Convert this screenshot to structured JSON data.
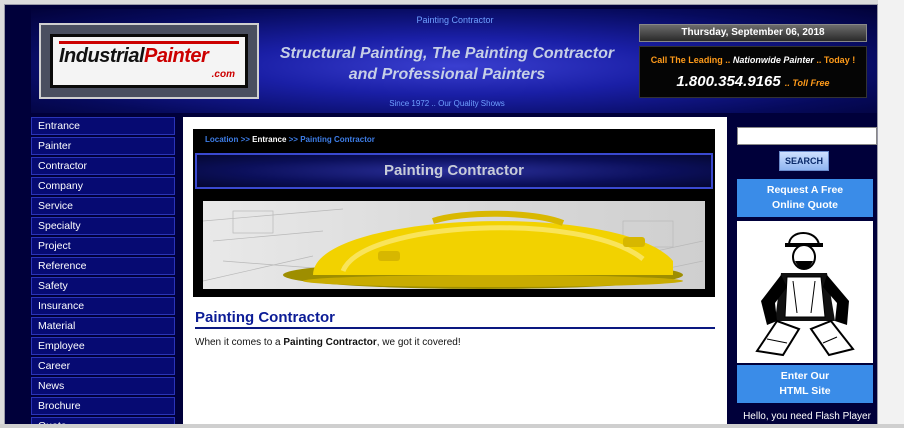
{
  "header": {
    "top_label": "Painting Contractor",
    "logo": {
      "word1": "Industrial",
      "word2": "Painter",
      "tld": ".com"
    },
    "tagline_line1": "Structural Painting, The Painting Contractor",
    "tagline_line2": "and Professional Painters",
    "since": "Since 1972 .. Our Quality Shows",
    "date": "Thursday, September 06, 2018",
    "call_prefix": "Call The Leading ..",
    "call_emph": "Nationwide Painter",
    "call_suffix": ".. Today !",
    "phone": "1.800.354.9165",
    "phone_suffix": ".. Toll Free"
  },
  "sidebar": {
    "items": [
      {
        "label": "Entrance"
      },
      {
        "label": "Painter"
      },
      {
        "label": "Contractor"
      },
      {
        "label": "Company"
      },
      {
        "label": "Service"
      },
      {
        "label": "Specialty"
      },
      {
        "label": "Project"
      },
      {
        "label": "Reference"
      },
      {
        "label": "Safety"
      },
      {
        "label": "Insurance"
      },
      {
        "label": "Material"
      },
      {
        "label": "Employee"
      },
      {
        "label": "Career"
      },
      {
        "label": "News"
      },
      {
        "label": "Brochure"
      },
      {
        "label": "Quote"
      }
    ]
  },
  "main": {
    "breadcrumb": {
      "root": "Location",
      "sep": ">>",
      "current": "Entrance",
      "page": "Painting Contractor"
    },
    "title": "Painting Contractor",
    "heading": "Painting Contractor",
    "body_prefix": "When it comes to a ",
    "body_bold": "Painting Contractor",
    "body_suffix": ", we got it covered!"
  },
  "right": {
    "search_value": "",
    "search_button": "SEARCH",
    "quote_line1": "Request A Free",
    "quote_line2": "Online Quote",
    "html_line1": "Enter Our",
    "html_line2": "HTML Site",
    "flash_text": "Hello, you need Flash Player"
  },
  "colors": {
    "page_bg": "#00003a",
    "nav_bg": "#060a72",
    "accent_blue": "#3a8ce8",
    "orange": "#ff9b1a",
    "heading_blue": "#0c1c96"
  }
}
